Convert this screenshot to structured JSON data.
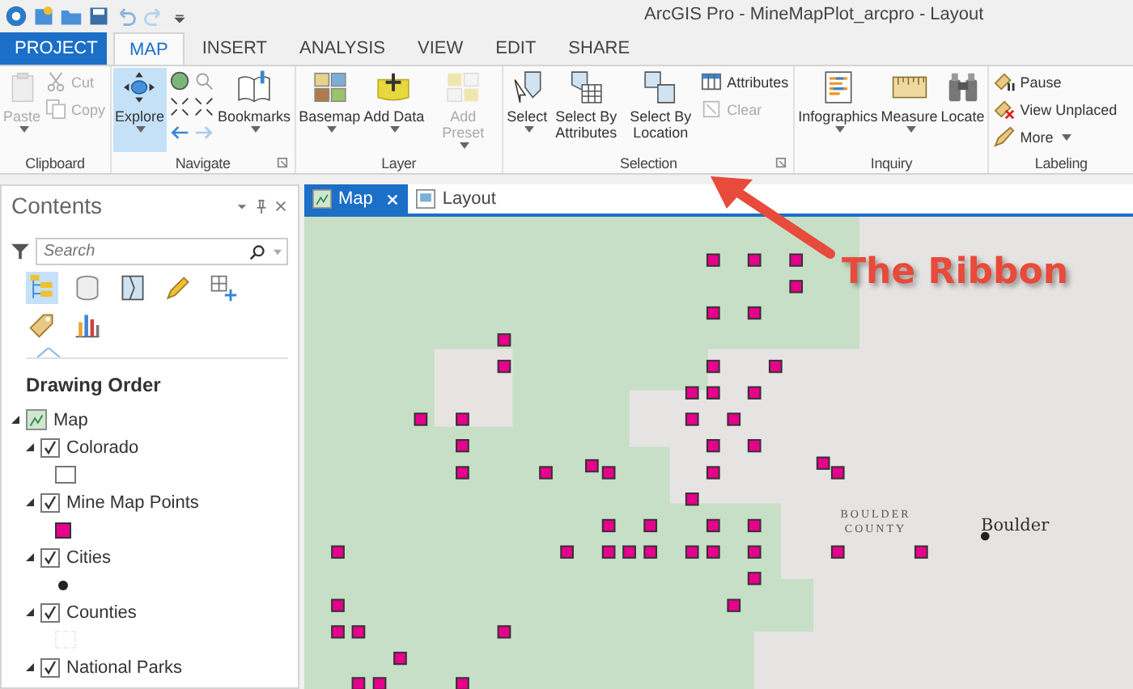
{
  "window": {
    "title": "ArcGIS Pro - MineMapPlot_arcpro - Layout"
  },
  "ribbon": {
    "tabs": [
      {
        "label": "PROJECT",
        "kind": "backstage",
        "selected": false
      },
      {
        "label": "MAP",
        "kind": "tab",
        "selected": true
      },
      {
        "label": "INSERT",
        "kind": "tab",
        "selected": false
      },
      {
        "label": "ANALYSIS",
        "kind": "tab",
        "selected": false
      },
      {
        "label": "VIEW",
        "kind": "tab",
        "selected": false
      },
      {
        "label": "EDIT",
        "kind": "tab",
        "selected": false
      },
      {
        "label": "SHARE",
        "kind": "tab",
        "selected": false
      }
    ],
    "groups": [
      {
        "title": "Clipboard",
        "launcher": false,
        "items": [
          {
            "kind": "big",
            "label": "Paste",
            "dropdown": true,
            "disabled": true,
            "selected": false
          },
          {
            "kind": "stack",
            "buttons": [
              {
                "label": "Cut",
                "disabled": true
              },
              {
                "label": "Copy",
                "disabled": true
              }
            ]
          }
        ]
      },
      {
        "title": "Navigate",
        "launcher": true,
        "items": [
          {
            "kind": "big",
            "label": "Explore",
            "dropdown": true,
            "disabled": false,
            "selected": true
          },
          {
            "kind": "icon-grid"
          },
          {
            "kind": "big",
            "label": "Bookmarks",
            "dropdown": true,
            "disabled": false,
            "selected": false
          }
        ]
      },
      {
        "title": "Layer",
        "launcher": false,
        "items": [
          {
            "kind": "big",
            "label": "Basemap",
            "dropdown": true,
            "disabled": false,
            "selected": false
          },
          {
            "kind": "big",
            "label": "Add Data",
            "dropdown": true,
            "disabled": false,
            "selected": false
          },
          {
            "kind": "big",
            "label": "Add Preset",
            "dropdown": true,
            "disabled": true,
            "selected": false
          }
        ]
      },
      {
        "title": "Selection",
        "launcher": true,
        "items": [
          {
            "kind": "big",
            "label": "Select",
            "dropdown": true,
            "disabled": false,
            "selected": false
          },
          {
            "kind": "big",
            "label": "Select By Attributes",
            "dropdown": false,
            "disabled": false,
            "selected": false
          },
          {
            "kind": "big",
            "label": "Select By Location",
            "dropdown": false,
            "disabled": false,
            "selected": false
          },
          {
            "kind": "stack",
            "buttons": [
              {
                "label": "Attributes",
                "disabled": false
              },
              {
                "label": "Clear",
                "disabled": true
              }
            ]
          }
        ]
      },
      {
        "title": "Inquiry",
        "launcher": false,
        "items": [
          {
            "kind": "big",
            "label": "Infographics",
            "dropdown": true,
            "disabled": false,
            "selected": false
          },
          {
            "kind": "big",
            "label": "Measure",
            "dropdown": true,
            "disabled": false,
            "selected": false
          },
          {
            "kind": "big",
            "label": "Locate",
            "dropdown": false,
            "disabled": false,
            "selected": false
          }
        ]
      },
      {
        "title": "Labeling",
        "launcher": false,
        "items": [
          {
            "kind": "stack",
            "buttons": [
              {
                "label": "Pause",
                "disabled": false
              },
              {
                "label": "View Unplaced",
                "disabled": false
              },
              {
                "label": "More",
                "disabled": false,
                "dropdown": true
              }
            ]
          }
        ]
      }
    ]
  },
  "contents": {
    "title": "Contents",
    "search": {
      "placeholder": "Search"
    },
    "heading": "Drawing Order",
    "tree": {
      "label": "Map",
      "expanded": true,
      "children": [
        {
          "label": "Colorado",
          "checked": true,
          "expanded": true,
          "symbol": {
            "kind": "outline"
          }
        },
        {
          "label": "Mine Map Points",
          "checked": true,
          "expanded": true,
          "symbol": {
            "kind": "square"
          }
        },
        {
          "label": "Cities",
          "checked": true,
          "expanded": true,
          "symbol": {
            "kind": "dot"
          }
        },
        {
          "label": "Counties",
          "checked": true,
          "expanded": true,
          "symbol": {
            "kind": "dashed"
          }
        },
        {
          "label": "National Parks",
          "checked": true,
          "expanded": true
        }
      ]
    }
  },
  "view_tabs": [
    {
      "label": "Map",
      "selected": true,
      "closable": true
    },
    {
      "label": "Layout",
      "selected": false,
      "closable": false
    }
  ],
  "map": {
    "labels": [
      {
        "kind": "county",
        "text": "BOULDER COUNTY"
      },
      {
        "kind": "city",
        "text": "Boulder"
      }
    ]
  },
  "annotation": {
    "text": "The Ribbon"
  }
}
